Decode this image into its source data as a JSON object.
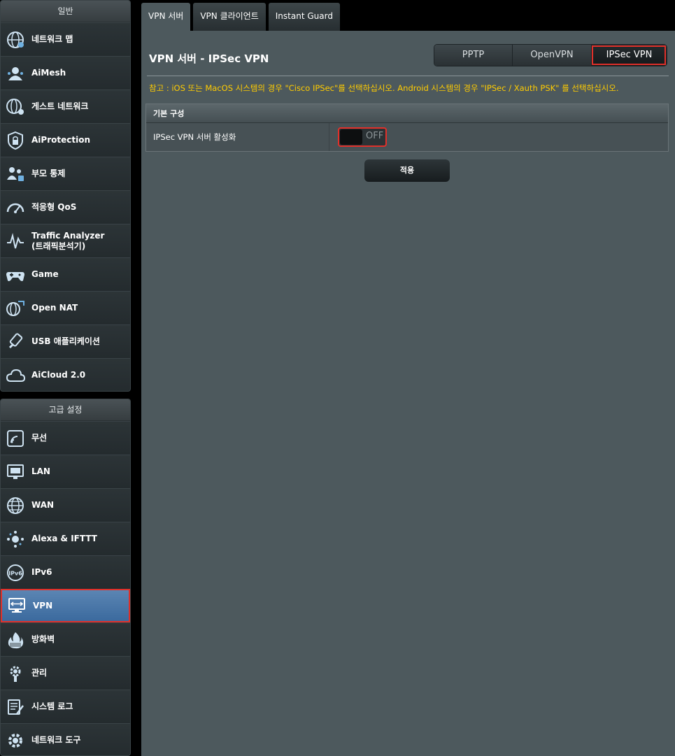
{
  "sidebar": {
    "general": {
      "header": "일반",
      "items": [
        {
          "label": "네트워크 맵",
          "icon": "network-map-icon"
        },
        {
          "label": "AiMesh",
          "icon": "aimesh-icon"
        },
        {
          "label": "게스트 네트워크",
          "icon": "guest-network-icon"
        },
        {
          "label": "AiProtection",
          "icon": "shield-lock-icon"
        },
        {
          "label": "부모 통제",
          "icon": "parental-control-icon"
        },
        {
          "label": "적응형 QoS",
          "icon": "qos-gauge-icon"
        },
        {
          "label": "Traffic Analyzer",
          "label2": "(트래픽분석기)",
          "icon": "traffic-analyzer-icon"
        },
        {
          "label": "Game",
          "icon": "game-controller-icon"
        },
        {
          "label": "Open NAT",
          "icon": "open-nat-icon"
        },
        {
          "label": "USB 애플리케이션",
          "icon": "usb-icon"
        },
        {
          "label": "AiCloud 2.0",
          "icon": "cloud-icon"
        }
      ]
    },
    "advanced": {
      "header": "고급 설정",
      "items": [
        {
          "label": "무선",
          "icon": "wireless-icon"
        },
        {
          "label": "LAN",
          "icon": "lan-icon"
        },
        {
          "label": "WAN",
          "icon": "globe-icon"
        },
        {
          "label": "Alexa & IFTTT",
          "icon": "alexa-icon"
        },
        {
          "label": "IPv6",
          "icon": "ipv6-icon"
        },
        {
          "label": "VPN",
          "icon": "vpn-monitor-icon"
        },
        {
          "label": "방화벽",
          "icon": "firewall-icon"
        },
        {
          "label": "관리",
          "icon": "admin-gear-icon"
        },
        {
          "label": "시스템 로그",
          "icon": "system-log-icon"
        },
        {
          "label": "네트워크 도구",
          "icon": "network-tools-icon"
        }
      ]
    }
  },
  "tabs": [
    "VPN 서버",
    "VPN 클라이언트",
    "Instant Guard"
  ],
  "page": {
    "title": "VPN 서버 - IPSec VPN",
    "protocols": [
      "PPTP",
      "OpenVPN",
      "IPSec VPN"
    ],
    "note": "참고 : iOS 또는 MacOS 시스템의 경우 \"Cisco IPSec\"를 선택하십시오. Android 시스템의 경우 \"IPSec / Xauth PSK\" 를 선택하십시오.",
    "section_header": "기본 구성",
    "enable_label": "IPSec VPN 서버 활성화",
    "toggle_state": "OFF",
    "apply_label": "적용"
  },
  "colors": {
    "accent_highlight": "#e0302a",
    "note_text": "#ffcc00",
    "panel_bg": "#4d595d",
    "active_menu": "#4a78aa"
  }
}
